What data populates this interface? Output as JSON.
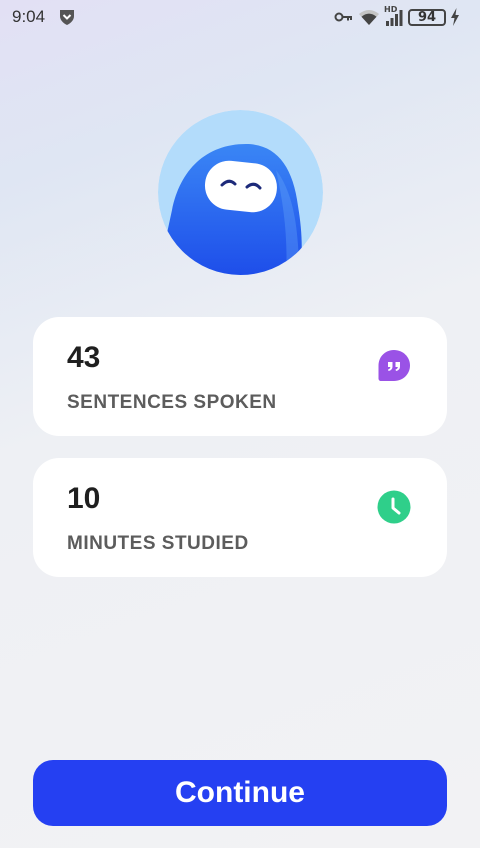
{
  "status_bar": {
    "time": "9:04",
    "battery": "94",
    "hd_label": "HD",
    "icons": [
      "shield-icon",
      "key-icon",
      "wifi-icon",
      "signal-icon",
      "battery-icon",
      "charging-icon"
    ]
  },
  "avatar": {
    "icon": "mascot-icon",
    "bg_color": "#b3dcfb",
    "body_color": "#2860f0"
  },
  "stats": [
    {
      "value": "43",
      "label": "SENTENCES SPOKEN",
      "icon": "quote-bubble-icon",
      "icon_color": "#9a52e6"
    },
    {
      "value": "10",
      "label": "MINUTES STUDIED",
      "icon": "clock-icon",
      "icon_color": "#2fcf8a"
    }
  ],
  "continue_button": {
    "label": "Continue",
    "color": "#2540f2"
  }
}
